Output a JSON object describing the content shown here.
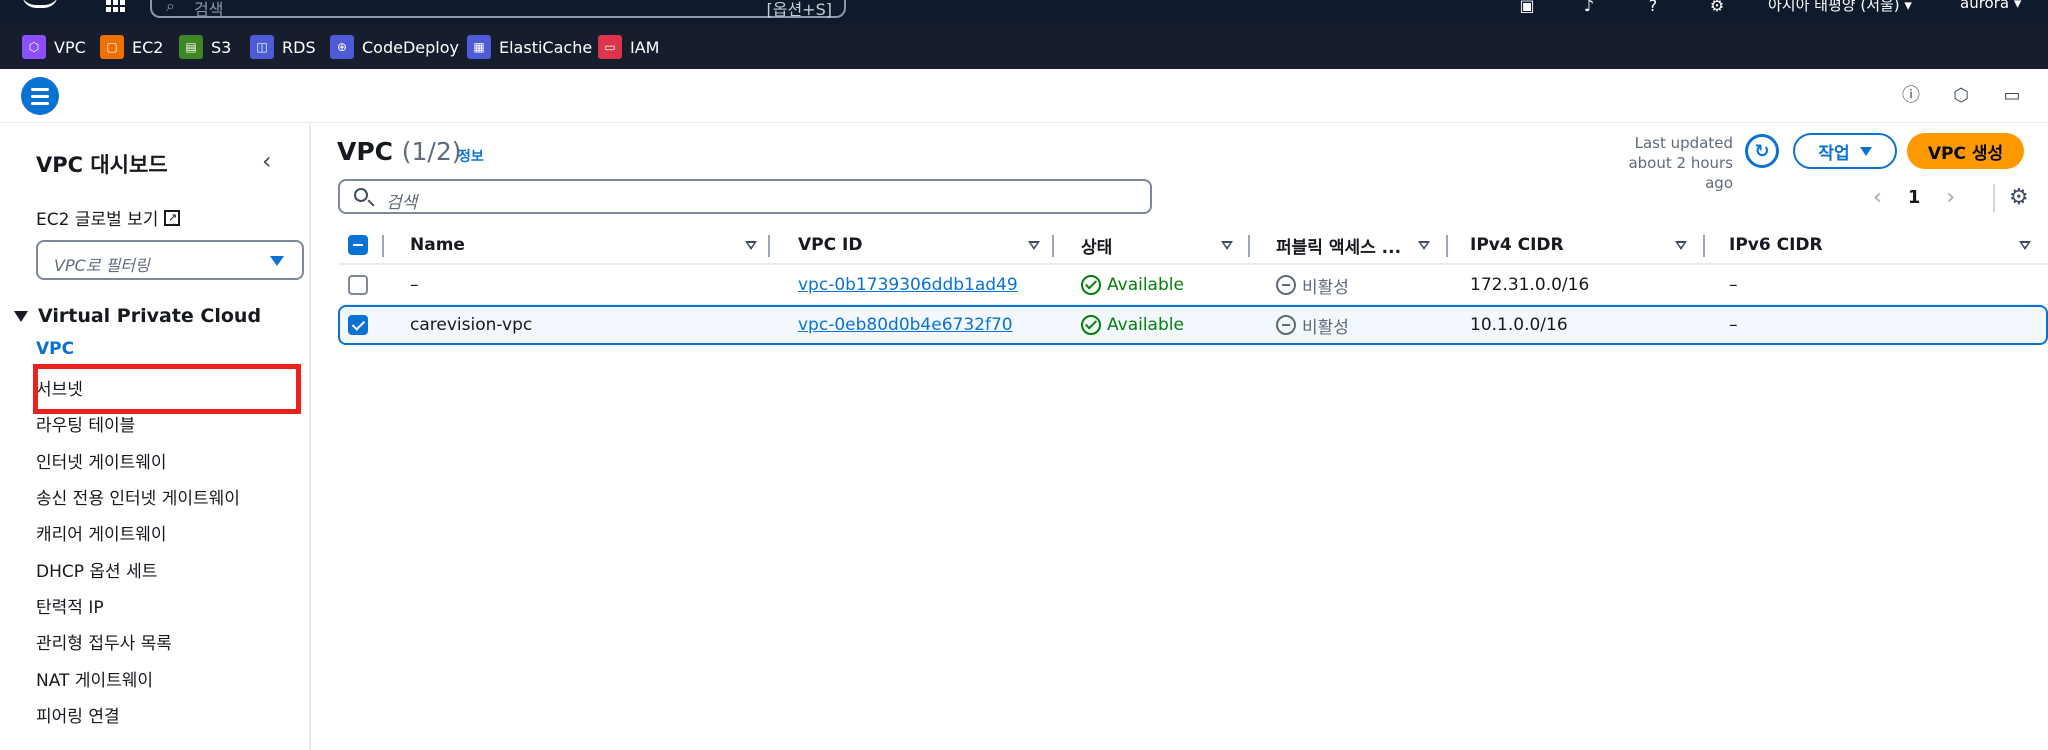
{
  "topnav": {
    "search_placeholder": "검색",
    "search_shortcut": "[옵션+S]",
    "region": "아시아 태평양 (서울) ▾",
    "user": "aurora ▾"
  },
  "favorites": [
    {
      "label": "VPC",
      "color": "#8c4fff"
    },
    {
      "label": "EC2",
      "color": "#ed7100"
    },
    {
      "label": "S3",
      "color": "#3f8624"
    },
    {
      "label": "RDS",
      "color": "#4d5bd6"
    },
    {
      "label": "CodeDeploy",
      "color": "#4d5bd6"
    },
    {
      "label": "ElastiCache",
      "color": "#4d5bd6"
    },
    {
      "label": "IAM",
      "color": "#dd344c"
    }
  ],
  "sidebar": {
    "title": "VPC 대시보드",
    "ec2_global_view": "EC2 글로벌 보기",
    "filter_placeholder": "VPC로 필터링",
    "section": "Virtual Private Cloud",
    "items": [
      {
        "label": "VPC",
        "active": true
      },
      {
        "label": "서브넷"
      },
      {
        "label": "라우팅 테이블"
      },
      {
        "label": "인터넷 게이트웨이"
      },
      {
        "label": "송신 전용 인터넷 게이트웨이"
      },
      {
        "label": "캐리어 게이트웨이"
      },
      {
        "label": "DHCP 옵션 세트"
      },
      {
        "label": "탄력적 IP"
      },
      {
        "label": "관리형 접두사 목록"
      },
      {
        "label": "NAT 게이트웨이"
      },
      {
        "label": "피어링 연결"
      }
    ]
  },
  "main": {
    "title": "VPC",
    "count": "(1/2)",
    "info": "정보",
    "last_updated_label": "Last updated",
    "last_updated_value": "about 2 hours ago",
    "actions_label": "작업",
    "create_label": "VPC 생성",
    "search_placeholder": "검색",
    "page": "1",
    "columns": [
      "Name",
      "VPC ID",
      "상태",
      "퍼블릭 액세스 ...",
      "IPv4 CIDR",
      "IPv6 CIDR"
    ],
    "rows": [
      {
        "name": "–",
        "vpc_id": "vpc-0b1739306ddb1ad49",
        "status": "Available",
        "public_access": "비활성",
        "ipv4": "172.31.0.0/16",
        "ipv6": "–",
        "selected": false
      },
      {
        "name": "carevision-vpc",
        "vpc_id": "vpc-0eb80d0b4e6732f70",
        "status": "Available",
        "public_access": "비활성",
        "ipv4": "10.1.0.0/16",
        "ipv6": "–",
        "selected": true
      }
    ]
  },
  "colors": {
    "accent": "#0972d3",
    "primary_button": "#ff9900",
    "status_ok": "#037f0c",
    "highlight": "#e8231d"
  }
}
